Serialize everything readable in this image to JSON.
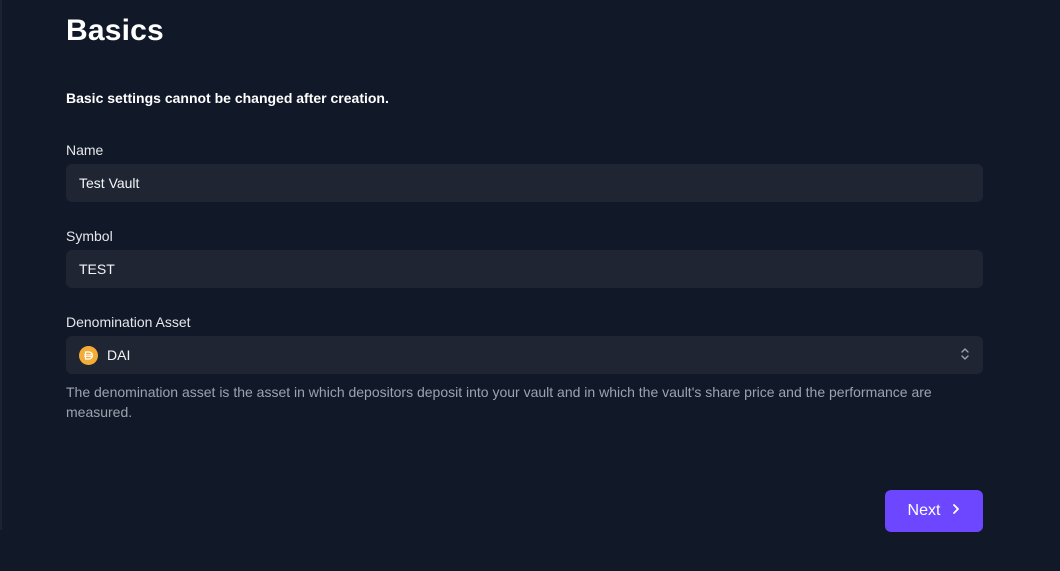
{
  "page": {
    "title": "Basics",
    "warning": "Basic settings cannot be changed after creation."
  },
  "form": {
    "name": {
      "label": "Name",
      "value": "Test Vault"
    },
    "symbol": {
      "label": "Symbol",
      "value": "TEST"
    },
    "denomination": {
      "label": "Denomination Asset",
      "value": "DAI",
      "icon": "dai-token-icon",
      "help": "The denomination asset is the asset in which depositors deposit into your vault and in which the vault's share price and the performance are measured."
    }
  },
  "actions": {
    "next_label": "Next"
  },
  "colors": {
    "background": "#111827",
    "input_bg": "#1f2532",
    "accent": "#6c47ff",
    "dai": "#f5ac37"
  }
}
